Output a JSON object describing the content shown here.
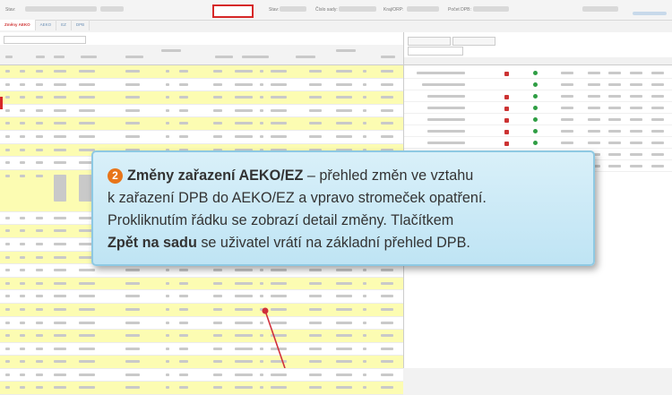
{
  "header": {
    "back_button_label": "Zpět na sadu",
    "info": [
      "Stav:",
      "Číslo sady:",
      "Kraj/ORP:",
      "Počet DPB:"
    ]
  },
  "tabs": [
    {
      "label": "Změny AEKO"
    },
    {
      "label": "AEKO"
    },
    {
      "label": "EZ"
    },
    {
      "label": "DPB"
    }
  ],
  "callout": {
    "number": "2",
    "title": "Změny zařazení AEKO/EZ",
    "line1": " – přehled změn ve vztahu",
    "line2": "k zařazení DPB do AEKO/EZ a vpravo stromeček opatření.",
    "line3": "Prokliknutím řádku se zobrazí detail změny. Tlačítkem",
    "bold2": "Zpět na sadu",
    "line4": " se uživatel vrátí na základní přehled DPB."
  },
  "colors": {
    "accent": "#e8751a",
    "highlight": "#fcfcb2",
    "border_red": "#d62828",
    "callout_bg": "#cdeaf6"
  }
}
